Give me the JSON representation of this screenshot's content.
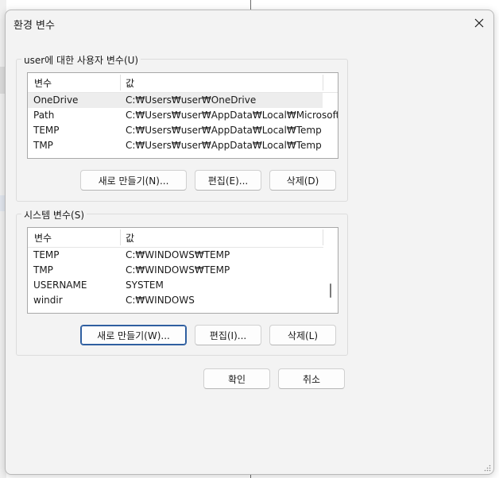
{
  "window": {
    "title": "환경 변수"
  },
  "user_vars": {
    "label": "user에 대한 사용자 변수(U)",
    "col_name": "변수",
    "col_value": "값",
    "rows": [
      {
        "name": "OneDrive",
        "value": "C:₩Users₩user₩OneDrive"
      },
      {
        "name": "Path",
        "value": "C:₩Users₩user₩AppData₩Local₩Microsoft..."
      },
      {
        "name": "TEMP",
        "value": "C:₩Users₩user₩AppData₩Local₩Temp"
      },
      {
        "name": "TMP",
        "value": "C:₩Users₩user₩AppData₩Local₩Temp"
      }
    ],
    "new_label": "새로 만들기(N)...",
    "edit_label": "편집(E)...",
    "delete_label": "삭제(D)"
  },
  "system_vars": {
    "label": "시스템 변수(S)",
    "col_name": "변수",
    "col_value": "값",
    "rows": [
      {
        "name": "TEMP",
        "value": "C:₩WINDOWS₩TEMP"
      },
      {
        "name": "TMP",
        "value": "C:₩WINDOWS₩TEMP"
      },
      {
        "name": "USERNAME",
        "value": "SYSTEM"
      },
      {
        "name": "windir",
        "value": "C:₩WINDOWS"
      }
    ],
    "new_label": "새로 만들기(W)...",
    "edit_label": "편집(I)...",
    "delete_label": "삭제(L)"
  },
  "footer": {
    "ok_label": "확인",
    "cancel_label": "취소"
  },
  "icons": {
    "close": "close-icon",
    "resize": "resize-grip-icon"
  },
  "colors": {
    "dialog_bg": "#f3f3f3",
    "default_button_border": "#2f5fa0",
    "selected_row": "#ededed"
  }
}
